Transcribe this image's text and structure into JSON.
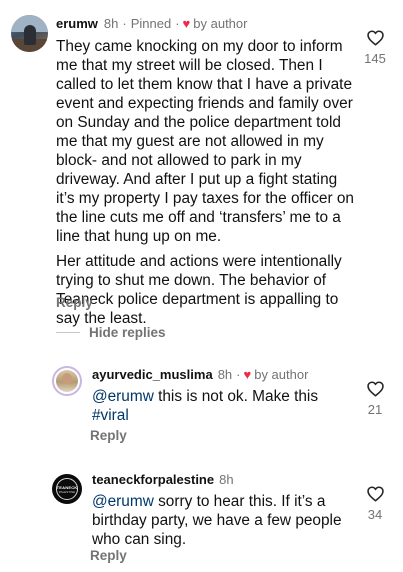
{
  "comment": {
    "username": "erumw",
    "time": "8h",
    "separator": "·",
    "pinned_label": "Pinned",
    "by_author_label": "by author",
    "paragraph_1": "They came knocking on my door to inform me that my street will be closed. Then I called to let them know that I have a private event and expecting friends and family over on Sunday and the police department told me that my guest are not allowed in my block- and not allowed to park in my driveway. And after I put up a fight stating it’s my property I pay taxes for the officer on the line cuts me off and ‘transfers’ me to a line that hung up on me.",
    "paragraph_2": "Her attitude and actions were intentionally trying to shut me down. The behavior of Teaneck police department is appalling to say the least.",
    "like_count": "145",
    "reply_label": "Reply"
  },
  "hide_replies_label": "Hide replies",
  "replies": [
    {
      "username": "ayurvedic_muslima",
      "time": "8h",
      "separator": "·",
      "by_author_label": "by author",
      "mention": "@erumw",
      "text": " this is not ok. Make this",
      "hashtag": "#viral",
      "like_count": "21",
      "reply_label": "Reply"
    },
    {
      "username": "teaneckforpalestine",
      "time": "8h",
      "mention": "@erumw",
      "text": " sorry to hear this. If it’s a birthday party, we have a few people who can sing.",
      "like_count": "34",
      "reply_label": "Reply"
    }
  ],
  "avatar_logo": {
    "line1": "TEANECK",
    "line2": "PALESTINE"
  },
  "colors": {
    "heart": "#ed2c4b",
    "muted": "#737373",
    "link": "#00376b"
  }
}
